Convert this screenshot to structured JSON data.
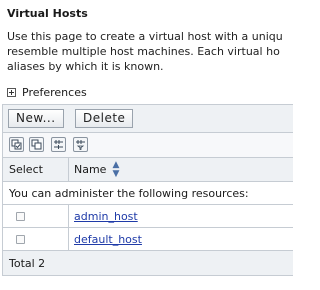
{
  "page": {
    "title": "Virtual Hosts",
    "description_lines": [
      "Use this page to create a virtual host with a uniqu",
      "resemble multiple host machines. Each virtual ho",
      "aliases by which it is known."
    ]
  },
  "preferences": {
    "label": "Preferences",
    "icon": "expand-plus-icon"
  },
  "toolbar": {
    "new_label": "New...",
    "delete_label": "Delete",
    "icons": [
      "select-all-icon",
      "deselect-all-icon",
      "show-filter-icon",
      "clear-filter-icon"
    ]
  },
  "table": {
    "columns": {
      "select": "Select",
      "name": "Name",
      "sort_icon": "sort-toggle-icon"
    },
    "info_message": "You can administer the following resources:",
    "rows": [
      {
        "name": "admin_host"
      },
      {
        "name": "default_host"
      }
    ],
    "total_label": "Total 2"
  },
  "colors": {
    "link": "#1f3ba8",
    "header_bg": "#eef1f4",
    "border": "#c6ccd3"
  }
}
